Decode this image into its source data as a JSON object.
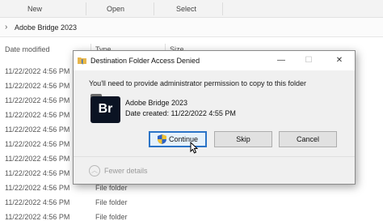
{
  "ribbon": {
    "new_label": "New",
    "open_label": "Open",
    "select_label": "Select"
  },
  "address": {
    "path": "Adobe Bridge 2023"
  },
  "columns": {
    "date_modified": "Date modified",
    "type": "Type",
    "size": "Size"
  },
  "rows": [
    {
      "date": "11/22/2022 4:56 PM",
      "type": ""
    },
    {
      "date": "11/22/2022 4:56 PM",
      "type": ""
    },
    {
      "date": "11/22/2022 4:56 PM",
      "type": ""
    },
    {
      "date": "11/22/2022 4:56 PM",
      "type": ""
    },
    {
      "date": "11/22/2022 4:56 PM",
      "type": ""
    },
    {
      "date": "11/22/2022 4:56 PM",
      "type": ""
    },
    {
      "date": "11/22/2022 4:56 PM",
      "type": ""
    },
    {
      "date": "11/22/2022 4:56 PM",
      "type": ""
    },
    {
      "date": "11/22/2022 4:56 PM",
      "type": "File folder"
    },
    {
      "date": "11/22/2022 4:56 PM",
      "type": "File folder"
    },
    {
      "date": "11/22/2022 4:56 PM",
      "type": "File folder"
    }
  ],
  "dialog": {
    "title": "Destination Folder Access Denied",
    "minimize_glyph": "—",
    "maximize_glyph": "☐",
    "close_glyph": "✕",
    "message": "You'll need to provide administrator permission to copy to this folder",
    "item_icon_text": "Br",
    "item_name": "Adobe Bridge 2023",
    "item_date": "Date created: 11/22/2022 4:55 PM",
    "continue_label": "Continue",
    "skip_label": "Skip",
    "cancel_label": "Cancel",
    "fewer_details_label": "Fewer details",
    "fewer_details_glyph": "︿",
    "accent_color": "#2b74c7",
    "icon_bg_color": "#0b1323"
  },
  "icons": {
    "title": "folder-shield-icon",
    "continue": "uac-shield-icon",
    "cursor": "mouse-pointer-icon",
    "fewer_details": "chevron-up-icon"
  }
}
